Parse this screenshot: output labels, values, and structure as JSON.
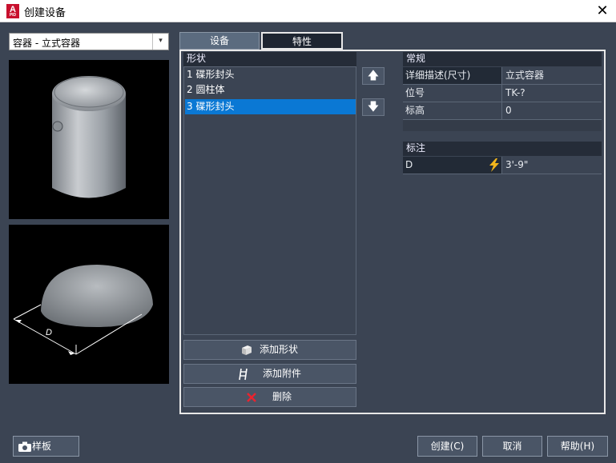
{
  "window": {
    "title": "创建设备",
    "close_glyph": "✕",
    "app_icon_letter": "A",
    "app_icon_sub": "PID"
  },
  "type_dropdown": {
    "value": "容器 - 立式容器",
    "arrow": "▾"
  },
  "tabs": {
    "equipment": "设备",
    "properties": "特性"
  },
  "shapes": {
    "header": "形状",
    "items": [
      "1 碟形封头",
      "2 圆柱体",
      "3 碟形封头"
    ],
    "selected_index": 2
  },
  "buttons": {
    "add_shape": "添加形状",
    "add_attachment": "添加附件",
    "delete": "删除",
    "up_glyph": "🡅",
    "down_glyph": "🡇"
  },
  "general": {
    "header": "常规",
    "rows": [
      {
        "key": "详细描述(尺寸)",
        "value": "立式容器"
      },
      {
        "key": "位号",
        "value": "TK-?"
      },
      {
        "key": "标高",
        "value": "0"
      }
    ]
  },
  "annotation": {
    "header": "标注",
    "rows": [
      {
        "key": "D",
        "value": "3'-9\""
      }
    ]
  },
  "preview_label": "D",
  "footer": {
    "template": "样板",
    "create": "创建(C)",
    "cancel": "取消",
    "help": "帮助(H)"
  },
  "colors": {
    "selection": "#0a78d4",
    "background": "#3b4453",
    "lightning": "#f2b51c",
    "delete_x": "#e8242f"
  }
}
